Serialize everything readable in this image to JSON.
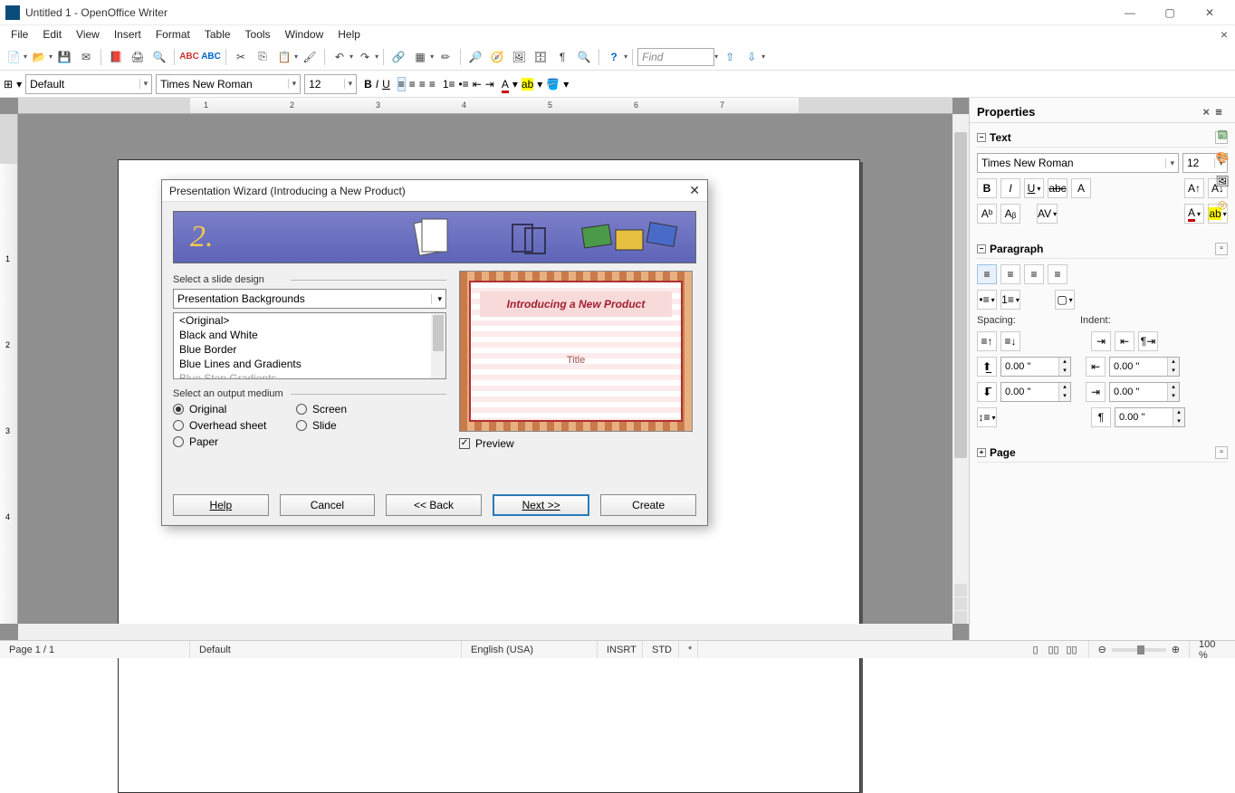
{
  "window": {
    "title": "Untitled 1 - OpenOffice Writer"
  },
  "menus": [
    "File",
    "Edit",
    "View",
    "Insert",
    "Format",
    "Table",
    "Tools",
    "Window",
    "Help"
  ],
  "find_placeholder": "Find",
  "format": {
    "style": "Default",
    "font": "Times New Roman",
    "size": "12"
  },
  "ruler_ticks": [
    "1",
    "2",
    "3",
    "4",
    "5",
    "6",
    "7"
  ],
  "v_ruler": [
    "1",
    "2",
    "3",
    "4"
  ],
  "properties": {
    "title": "Properties",
    "text": {
      "label": "Text",
      "font": "Times New Roman",
      "size": "12"
    },
    "paragraph": {
      "label": "Paragraph",
      "spacing_label": "Spacing:",
      "indent_label": "Indent:",
      "v1": "0.00 \"",
      "v2": "0.00 \"",
      "v3": "0.00 \"",
      "v4": "0.00 \"",
      "v5": "0.00 \""
    },
    "page": {
      "label": "Page"
    }
  },
  "dialog": {
    "title": "Presentation Wizard (Introducing a New Product)",
    "step": "2.",
    "select_design_label": "Select a slide design",
    "design_category": "Presentation Backgrounds",
    "design_list": [
      "<Original>",
      "Black and White",
      "Blue Border",
      "Blue Lines and Gradients",
      "Blue Step Gradients"
    ],
    "output_label": "Select an output medium",
    "radios": {
      "original": "Original",
      "screen": "Screen",
      "overhead": "Overhead sheet",
      "slide": "Slide",
      "paper": "Paper"
    },
    "preview_title": "Introducing a New Product",
    "preview_sub": "Title",
    "preview_chk": "Preview",
    "buttons": {
      "help": "Help",
      "cancel": "Cancel",
      "back": "<< Back",
      "next": "Next >>",
      "create": "Create"
    }
  },
  "status": {
    "page": "Page 1 / 1",
    "style": "Default",
    "lang": "English (USA)",
    "insrt": "INSRT",
    "std": "STD",
    "zoom": "100 %"
  }
}
